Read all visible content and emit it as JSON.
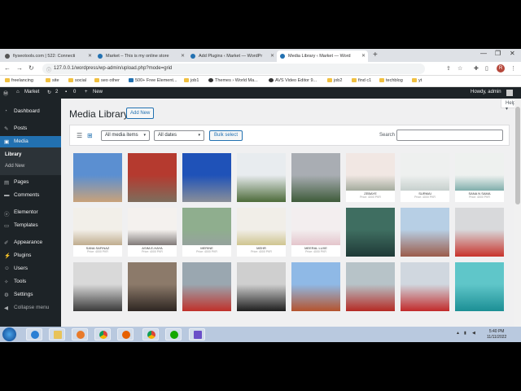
{
  "browser": {
    "tabs": [
      {
        "title": "fiyseotools.com | 522: Connecti"
      },
      {
        "title": "Market – This is my online store"
      },
      {
        "title": "Add Plugins ‹ Market — WordPr"
      },
      {
        "title": "Media Library ‹ Market — Word"
      }
    ],
    "url": "127.0.0.1/wordpress/wp-admin/upload.php?mode=grid",
    "profile_initial": "R",
    "bookmarks": [
      "freelancing",
      "site",
      "social",
      "seo other",
      "500+ Free Element...",
      "job1",
      "Themes › World Ma...",
      "AVS Video Editor 9...",
      "job2",
      "find c1",
      "techblog",
      "yt"
    ]
  },
  "adminbar": {
    "site_name": "Market",
    "updates": "2",
    "comments": "0",
    "new_label": "New",
    "howdy": "Howdy, admin"
  },
  "sidebar": {
    "items": [
      {
        "label": "Dashboard",
        "icon": "dashboard-icon"
      },
      {
        "label": "Posts",
        "icon": "pin-icon"
      },
      {
        "label": "Media",
        "icon": "media-icon"
      },
      {
        "label": "Pages",
        "icon": "page-icon"
      },
      {
        "label": "Comments",
        "icon": "comment-icon"
      },
      {
        "label": "Elementor",
        "icon": "elementor-icon"
      },
      {
        "label": "Templates",
        "icon": "folder-icon"
      },
      {
        "label": "Appearance",
        "icon": "brush-icon"
      },
      {
        "label": "Plugins",
        "icon": "plug-icon"
      },
      {
        "label": "Users",
        "icon": "user-icon"
      },
      {
        "label": "Tools",
        "icon": "wrench-icon"
      },
      {
        "label": "Settings",
        "icon": "settings-icon"
      },
      {
        "label": "Collapse menu",
        "icon": "collapse-icon"
      }
    ],
    "submenu": [
      "Library",
      "Add New"
    ]
  },
  "main": {
    "title": "Media Library",
    "add_new": "Add New",
    "help": "Help ▾",
    "filter_type": "All media items",
    "filter_date": "All dates",
    "bulk_select": "Bulk select",
    "search_label": "Search"
  },
  "media": [
    {
      "caption": "",
      "price": "",
      "colors": [
        "#5b8fd1",
        "#c9a27a"
      ]
    },
    {
      "caption": "",
      "price": "",
      "colors": [
        "#b53a2f",
        "#7d6d5c"
      ]
    },
    {
      "caption": "",
      "price": "",
      "colors": [
        "#1f52b8",
        "#8a8f99"
      ]
    },
    {
      "caption": "",
      "price": "",
      "colors": [
        "#e8ecef",
        "#4d6b3a"
      ]
    },
    {
      "caption": "",
      "price": "",
      "colors": [
        "#a9adb3",
        "#3e5b3a"
      ]
    },
    {
      "caption": "ZEBAYE",
      "price": "Price: 4000 PKR",
      "colors": [
        "#f1e7e3",
        "#6b7f6a"
      ]
    },
    {
      "caption": "SURMAI",
      "price": "Price: 4000 PKR",
      "colors": [
        "#eef0ef",
        "#a8b8b4"
      ]
    },
    {
      "caption": "SANA N SAMA",
      "price": "Price: 4000 PKR",
      "colors": [
        "#eef1ef",
        "#2f7d7a"
      ]
    },
    {
      "caption": "SANA SAFINAZ",
      "price": "Price: 4000 PKR",
      "colors": [
        "#f2efe9",
        "#9a7b4b"
      ]
    },
    {
      "caption": "ASIM-E-HAYA",
      "price": "Price: 4000 PKR",
      "colors": [
        "#f4f1ee",
        "#2b2323"
      ]
    },
    {
      "caption": "MERINE",
      "price": "Price: 4000 PKR",
      "colors": [
        "#8fae8e",
        "#9a9aa8"
      ]
    },
    {
      "caption": "MEHR",
      "price": "Price: 4000 PKR",
      "colors": [
        "#f1eee8",
        "#b6a64f"
      ]
    },
    {
      "caption": "MEERAL LUXE",
      "price": "Price: 4000 PKR",
      "colors": [
        "#f3eeef",
        "#d9a7b2"
      ]
    },
    {
      "caption": "",
      "price": "",
      "colors": [
        "#3f6e61",
        "#1f3a37"
      ]
    },
    {
      "caption": "",
      "price": "",
      "colors": [
        "#b7cfe5",
        "#9b5b4a"
      ]
    },
    {
      "caption": "",
      "price": "",
      "colors": [
        "#d8d9db",
        "#c8342c"
      ]
    },
    {
      "caption": "",
      "price": "",
      "colors": [
        "#d9d9d9",
        "#3a3a3a"
      ]
    },
    {
      "caption": "",
      "price": "",
      "colors": [
        "#8c7a6a",
        "#2e2622"
      ]
    },
    {
      "caption": "",
      "price": "",
      "colors": [
        "#9aa7b0",
        "#c0302a"
      ]
    },
    {
      "caption": "",
      "price": "",
      "colors": [
        "#cfcfcf",
        "#1e1e1e"
      ]
    },
    {
      "caption": "",
      "price": "",
      "colors": [
        "#8fb9e6",
        "#b5532d"
      ]
    },
    {
      "caption": "",
      "price": "",
      "colors": [
        "#b7c3c8",
        "#b52a24"
      ]
    },
    {
      "caption": "",
      "price": "",
      "colors": [
        "#d0d7df",
        "#c22a2a"
      ]
    },
    {
      "caption": "",
      "price": "",
      "colors": [
        "#5fc6c9",
        "#1c8f95"
      ]
    }
  ],
  "taskbar": {
    "apps": [
      "ie-icon",
      "explorer-icon",
      "media-player-icon",
      "chrome-icon",
      "firefox-icon",
      "chrome-alt-icon",
      "upwork-icon",
      "app-icon"
    ],
    "time": "5:40 PM",
    "date": "11/11/2022"
  },
  "colors": {
    "wp_dark": "#1d2327",
    "wp_blue": "#2271b1"
  }
}
